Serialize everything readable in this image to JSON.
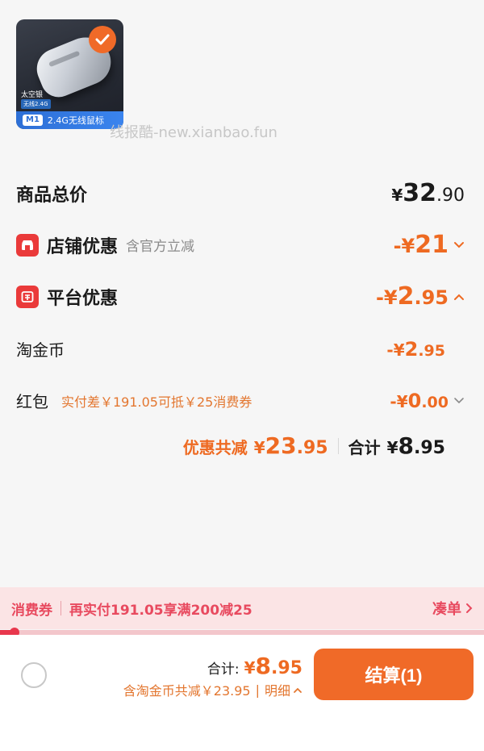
{
  "product": {
    "color_text": "太空银",
    "small_tag": "无线2.4G",
    "model_badge": "M1",
    "banner_text": "2.4G无线鼠标"
  },
  "watermark": "线报酷-new.xianbao.fun",
  "price_rows": {
    "total_goods": {
      "label": "商品总价",
      "symbol": "¥",
      "int": "32",
      "dec": ".90"
    },
    "shop_discount": {
      "label": "店铺优惠",
      "note": "含官方立减",
      "prefix": "-¥",
      "int": "21",
      "dec": ""
    },
    "platform_discount": {
      "label": "平台优惠",
      "prefix": "-¥",
      "int": "2",
      "dec": ".95"
    },
    "gold_coin": {
      "label": "淘金币",
      "prefix": "-¥",
      "int": "2",
      "dec": ".95"
    },
    "red_packet": {
      "label": "红包",
      "note": "实付差￥191.05可抵￥25消费券",
      "prefix": "-¥",
      "int": "0",
      "dec": ".00"
    }
  },
  "summary": {
    "discount_label": "优惠共减",
    "discount_symbol": "¥",
    "discount_int": "23",
    "discount_dec": ".95",
    "total_label": "合计",
    "total_symbol": "¥",
    "total_int": "8",
    "total_dec": ".95"
  },
  "coupon": {
    "title": "消费券",
    "text": "再实付191.05享满200减25",
    "link": "凑单",
    "progress": 0.03
  },
  "bottom": {
    "total_label": "合计:",
    "total_symbol": "¥",
    "total_int": "8",
    "total_dec": ".95",
    "detail_text": "含淘金币共减￥23.95",
    "detail_link": "明细",
    "checkout_label": "结算(1)"
  },
  "colors": {
    "accent_orange": "#f06a28",
    "discount_orange": "#ee6a22",
    "coupon_red": "#e84a5f",
    "icon_red": "#ea3a3a"
  },
  "icons": {
    "check": "check-icon",
    "shop": "shop-icon",
    "platform": "platform-icon",
    "chevron_down": "chevron-down-icon",
    "chevron_up": "chevron-up-icon",
    "chevron_right": "chevron-right-icon"
  }
}
